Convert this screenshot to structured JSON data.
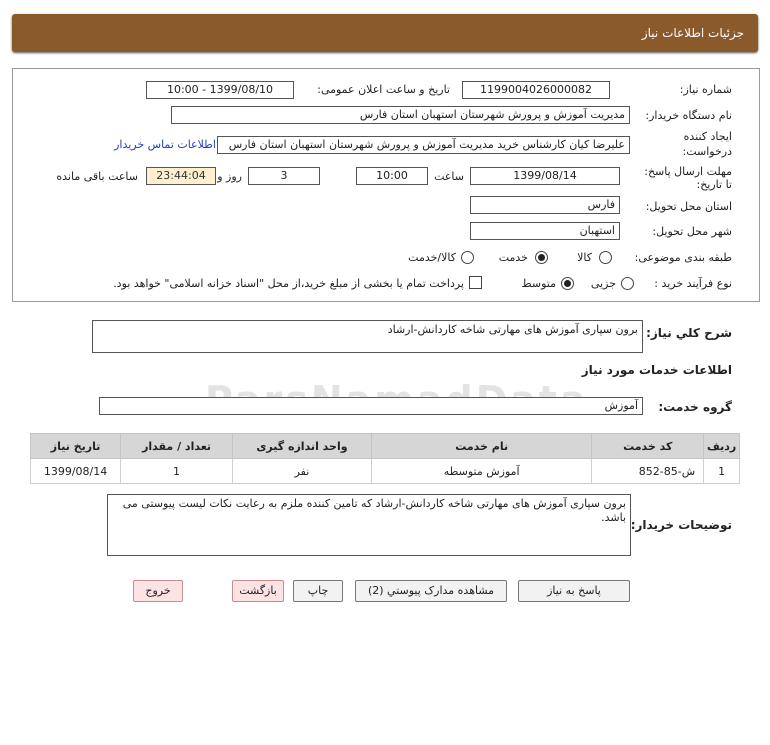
{
  "header": {
    "title": "جزئیات اطلاعات نیاز"
  },
  "form": {
    "need_number_label": "شماره نیاز:",
    "need_number": "1199004026000082",
    "announce_label": "تاریخ و ساعت اعلان عمومی:",
    "announce_value": "1399/08/10 - 10:00",
    "buyer_org_label": "نام دستگاه خریدار:",
    "buyer_org": "مدیریت آموزش و پرورش شهرستان استهبان استان فارس",
    "creator_label_1": "ایجاد کننده",
    "creator_label_2": "درخواست:",
    "creator": "علیرضا کیان کارشناس خرید مدیریت آموزش و پرورش شهرستان استهبان استان فارس",
    "contact_link": "اطلاعات تماس خریدار",
    "deadline_label_1": "مهلت ارسال پاسخ:",
    "deadline_label_2": "تا تاریخ:",
    "deadline_date": "1399/08/14",
    "time_label": "ساعت",
    "deadline_time": "10:00",
    "days": "3",
    "days_label": "روز و",
    "remaining": "23:44:04",
    "remaining_label": "ساعت باقی مانده",
    "province_label": "استان محل تحویل:",
    "province": "فارس",
    "city_label": "شهر محل تحویل:",
    "city": "استهبان",
    "category_label": "طبقه بندی موضوعی:",
    "category_options": [
      "کالا",
      "خدمت",
      "کالا/خدمت"
    ],
    "process_label": "نوع فرآیند خرید :",
    "process_options": [
      "جزیی",
      "متوسط"
    ],
    "payment_note": "پرداخت تمام یا بخشی از مبلغ خرید،از محل \"اسناد خزانه اسلامی\" خواهد بود."
  },
  "summary": {
    "label": "شرح کلي نياز:",
    "value": "برون سپاری آموزش های مهارتی شاخه کاردانش-ارشاد"
  },
  "services": {
    "section_title": "اطلاعات خدمات مورد نیاز",
    "group_label": "گروه خدمت:",
    "group_value": "آموزش",
    "columns": [
      "ردیف",
      "کد خدمت",
      "نام خدمت",
      "واحد اندازه گیری",
      "تعداد / مقدار",
      "تاریخ نیاز"
    ],
    "rows": [
      [
        "1",
        "ش-85-852",
        "آموزش متوسطه",
        "نفر",
        "1",
        "1399/08/14"
      ]
    ]
  },
  "buyer_notes": {
    "label": "توضیحات خریدار:",
    "value": "برون سپاری آموزش های مهارتی شاخه کاردانش-ارشاد که تامین کننده ملزم به رعایت نکات لیست پیوستی می باشد."
  },
  "buttons": {
    "reply": "پاسخ به نیاز",
    "attachments": "مشاهده مدارک پیوستي (2)",
    "print": "چاپ",
    "back": "بازگشت",
    "exit": "خروج"
  }
}
